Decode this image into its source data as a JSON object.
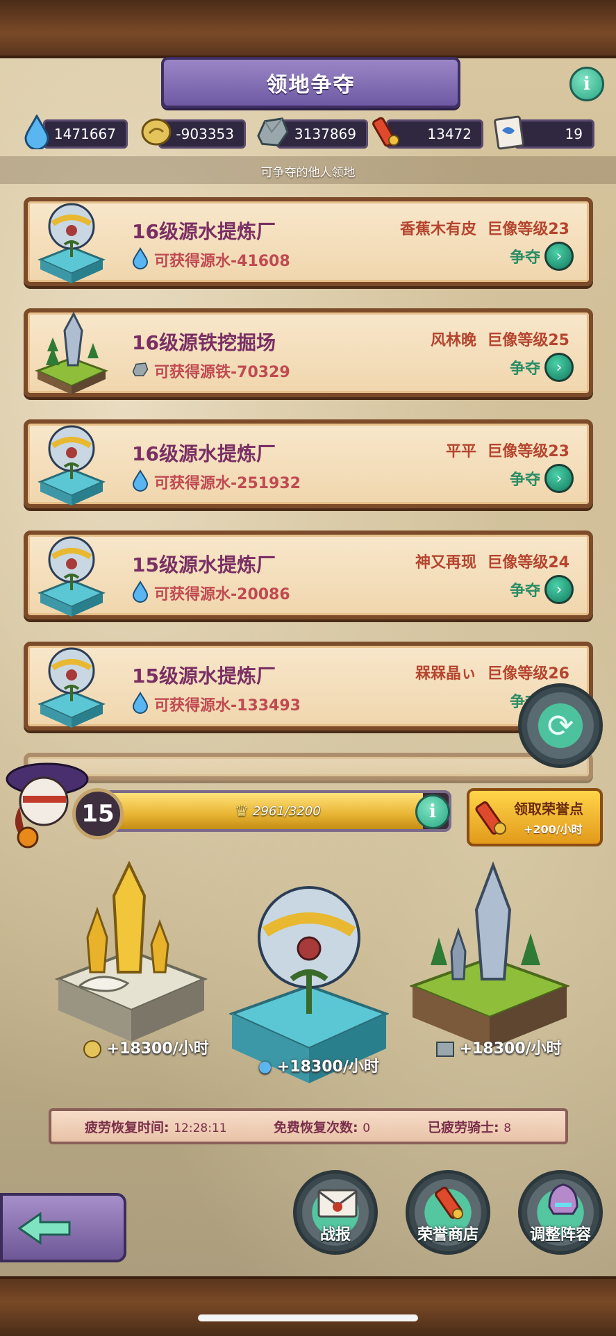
{
  "header": {
    "title": "领地争夺",
    "info_icon": "info-icon"
  },
  "resources": [
    {
      "icon": "water-drop-icon",
      "value": "1471667"
    },
    {
      "icon": "gold-coin-icon",
      "value": "-903353"
    },
    {
      "icon": "iron-ore-icon",
      "value": "3137869"
    },
    {
      "icon": "honor-scroll-icon",
      "value": "13472"
    },
    {
      "icon": "card-icon",
      "value": "19"
    }
  ],
  "subtitle": "可争夺的他人领地",
  "territories": [
    {
      "name": "16级源水提炼厂",
      "gain": "可获得源水-41608",
      "gain_icon": "water-drop-icon",
      "owner": "香蕉木有皮",
      "statue": "巨像等级23",
      "action": "争夺",
      "thumb": "water-refinery"
    },
    {
      "name": "16级源铁挖掘场",
      "gain": "可获得源铁-70329",
      "gain_icon": "iron-ore-icon",
      "owner": "风林晚",
      "statue": "巨像等级25",
      "action": "争夺",
      "thumb": "iron-mine"
    },
    {
      "name": "16级源水提炼厂",
      "gain": "可获得源水-251932",
      "gain_icon": "water-drop-icon",
      "owner": "平平",
      "statue": "巨像等级23",
      "action": "争夺",
      "thumb": "water-refinery"
    },
    {
      "name": "15级源水提炼厂",
      "gain": "可获得源水-20086",
      "gain_icon": "water-drop-icon",
      "owner": "神又再现",
      "statue": "巨像等级24",
      "action": "争夺",
      "thumb": "water-refinery"
    },
    {
      "name": "15级源水提炼厂",
      "gain": "可获得源水-133493",
      "gain_icon": "water-drop-icon",
      "owner": "槑槑晶ぃ",
      "statue": "巨像等级26",
      "action": "争夺",
      "thumb": "water-refinery"
    }
  ],
  "player": {
    "level": "15",
    "progress_text": "2961/3200",
    "progress_fraction": 0.925,
    "accent": "#e8b433"
  },
  "honor_button": {
    "label": "领取荣誉点",
    "rate": "+200/小时"
  },
  "production": [
    {
      "icon": "gold-coin-icon",
      "rate": "+18300/小时"
    },
    {
      "icon": "water-drop-icon",
      "rate": "+18300/小时"
    },
    {
      "icon": "iron-ore-icon",
      "rate": "+18300/小时"
    }
  ],
  "fatigue": {
    "recover_time_label": "疲劳恢复时间:",
    "recover_time": "12:28:11",
    "free_recover_label": "免费恢复次数:",
    "free_recover": "0",
    "tired_knights_label": "已疲劳骑士:",
    "tired_knights": "8"
  },
  "bottom_nav": {
    "battle_report": "战报",
    "honor_shop": "荣誉商店",
    "adjust_lineup": "调整阵容"
  }
}
